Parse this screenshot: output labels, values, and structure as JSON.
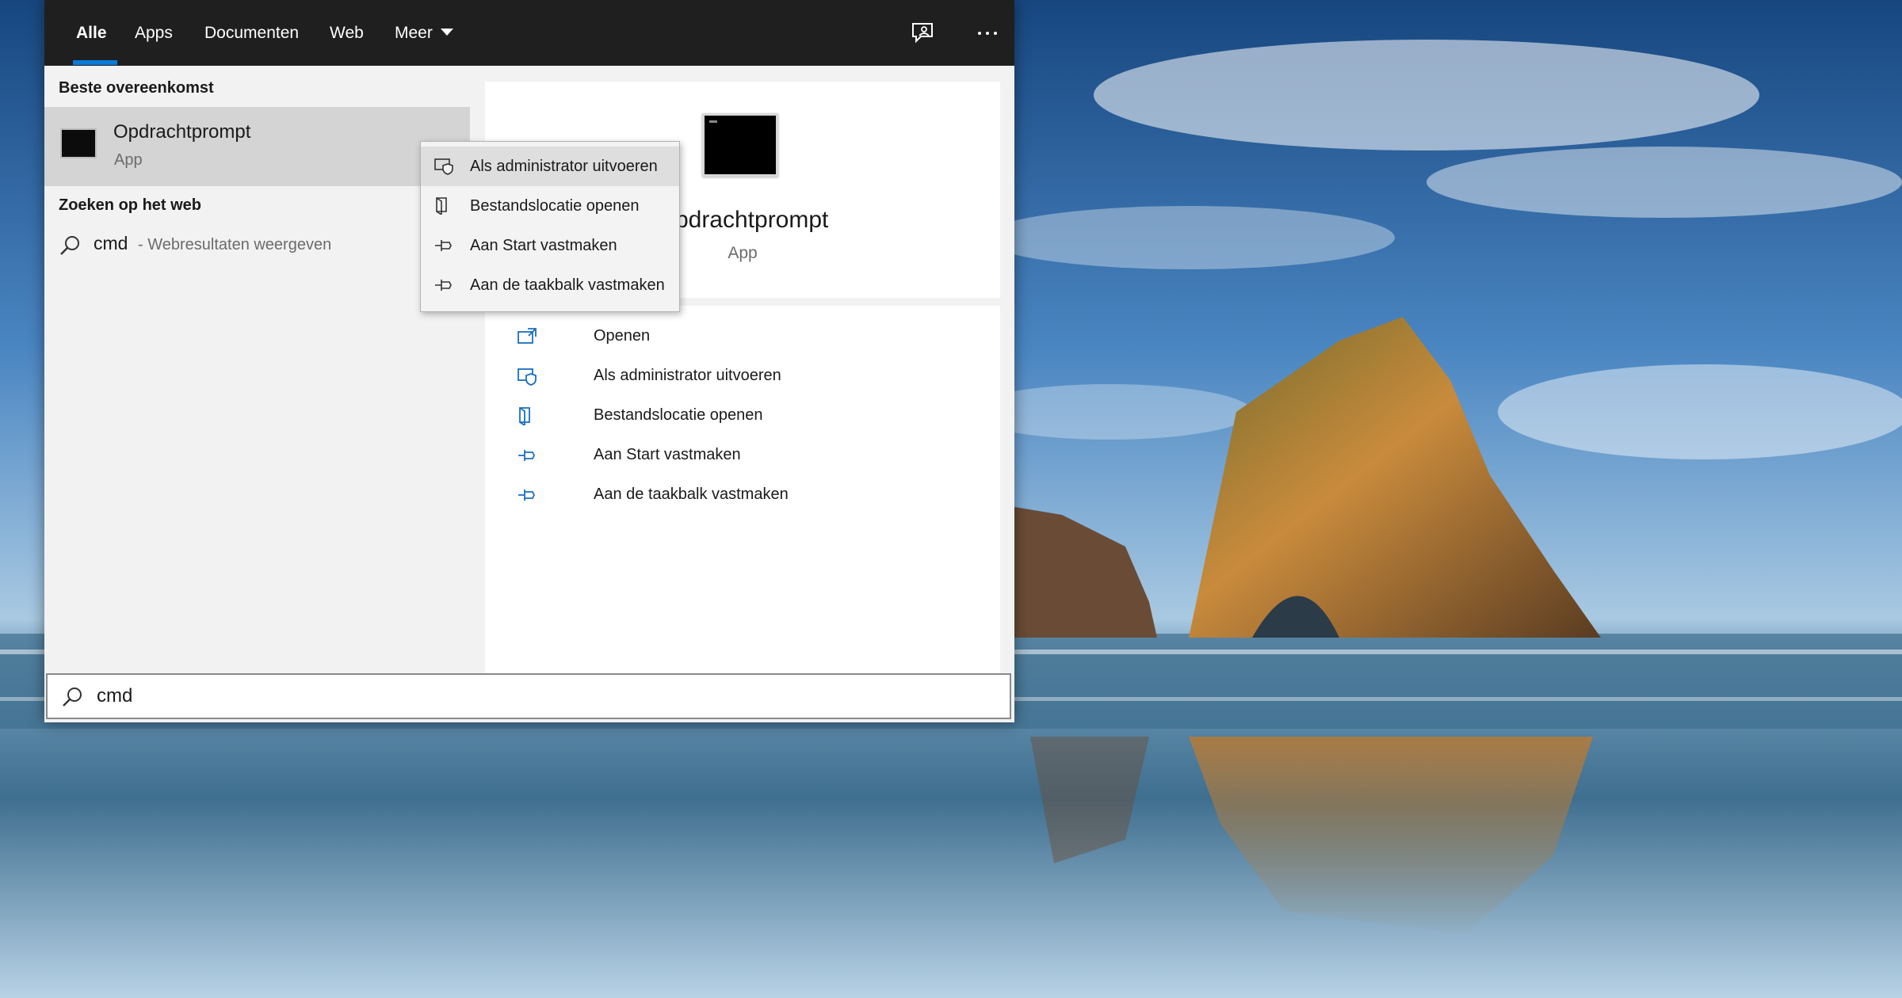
{
  "tabs": [
    {
      "label": "Alle",
      "active": true
    },
    {
      "label": "Apps"
    },
    {
      "label": "Documenten"
    },
    {
      "label": "Web"
    },
    {
      "label": "Meer"
    }
  ],
  "topbar_icons": [
    "feedback-icon",
    "more-options-icon"
  ],
  "best_match": {
    "heading": "Beste overeenkomst",
    "title": "Opdrachtprompt",
    "subtitle": "App",
    "icon": "command-prompt-icon"
  },
  "web_search": {
    "heading": "Zoeken op het web",
    "query": "cmd",
    "hint": "- Webresultaten weergeven"
  },
  "preview": {
    "title": "Opdrachtprompt",
    "subtitle": "App",
    "actions": [
      {
        "label": "Openen",
        "icon": "open-icon"
      },
      {
        "label": "Als administrator uitvoeren",
        "icon": "shield-icon"
      },
      {
        "label": "Bestandslocatie openen",
        "icon": "file-location-icon"
      },
      {
        "label": "Aan Start vastmaken",
        "icon": "pin-icon"
      },
      {
        "label": "Aan de taakbalk vastmaken",
        "icon": "pin-icon"
      }
    ]
  },
  "context_menu": {
    "items": [
      {
        "label": "Als administrator uitvoeren",
        "icon": "shield-icon",
        "highlighted": true
      },
      {
        "label": "Bestandslocatie openen",
        "icon": "file-location-icon"
      },
      {
        "label": "Aan Start vastmaken",
        "icon": "pin-icon"
      },
      {
        "label": "Aan de taakbalk vastmaken",
        "icon": "pin-icon"
      }
    ]
  },
  "search": {
    "value": "cmd"
  },
  "colors": {
    "accent": "#0a7bd8",
    "topbar": "#1f1f1f",
    "panel": "#f2f2f2",
    "selected_row": "#d4d4d4"
  }
}
